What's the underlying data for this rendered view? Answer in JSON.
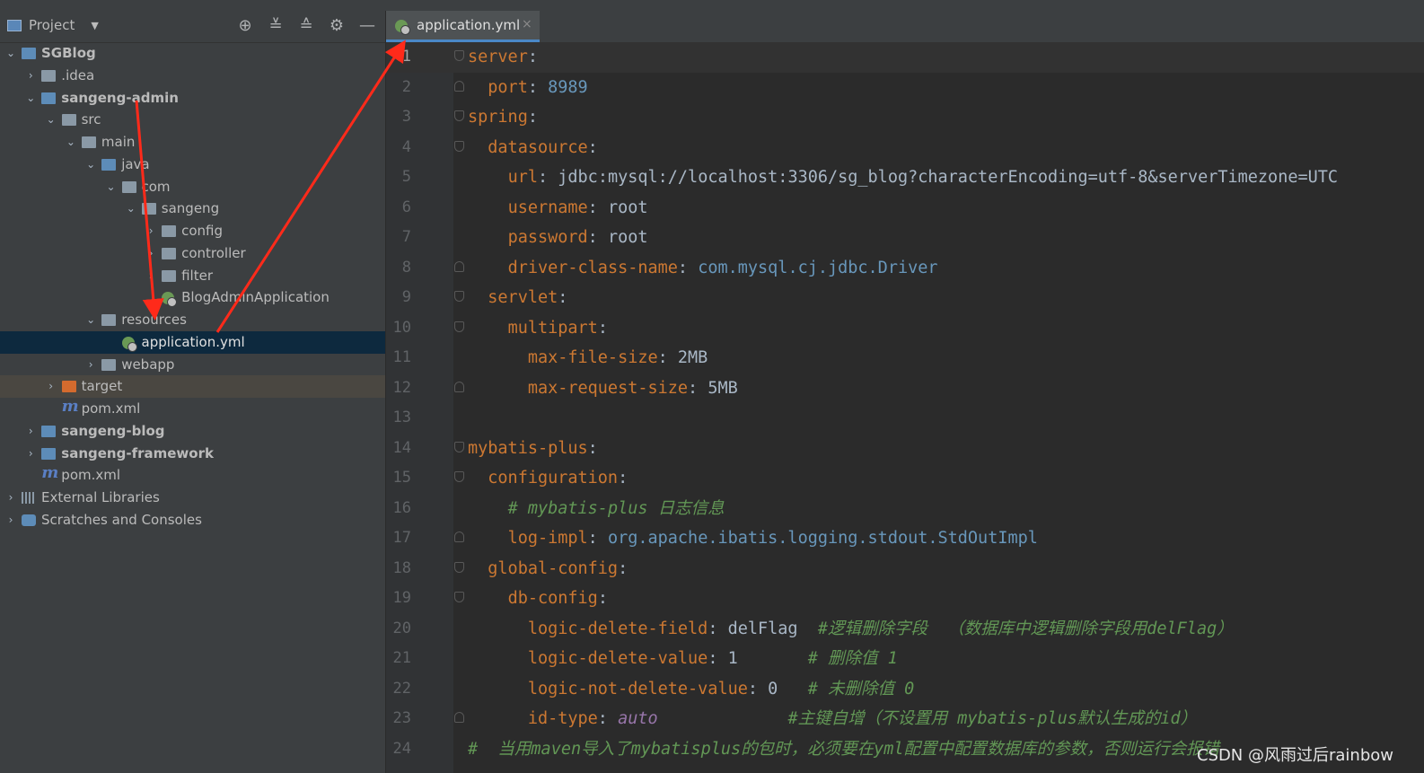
{
  "project_panel": {
    "title": "Project",
    "header_icons": [
      "locate-icon",
      "expand-all-icon",
      "collapse-all-icon",
      "settings-icon",
      "hide-icon"
    ],
    "tree": [
      {
        "label": "SGBlog",
        "path": "D:\\Java\\projects\\SGBlog",
        "depth": 0,
        "expanded": true,
        "icon": "module-folder-icon",
        "bold": true
      },
      {
        "label": ".idea",
        "depth": 1,
        "expanded": false,
        "icon": "folder-icon"
      },
      {
        "label": "sangeng-admin",
        "depth": 1,
        "expanded": true,
        "icon": "module-folder-icon",
        "bold": true
      },
      {
        "label": "src",
        "depth": 2,
        "expanded": true,
        "icon": "folder-icon"
      },
      {
        "label": "main",
        "depth": 3,
        "expanded": true,
        "icon": "folder-icon"
      },
      {
        "label": "java",
        "depth": 4,
        "expanded": true,
        "icon": "source-folder-icon"
      },
      {
        "label": "com",
        "depth": 5,
        "expanded": true,
        "icon": "package-icon"
      },
      {
        "label": "sangeng",
        "depth": 6,
        "expanded": true,
        "icon": "package-icon"
      },
      {
        "label": "config",
        "depth": 7,
        "expanded": false,
        "icon": "package-icon"
      },
      {
        "label": "controller",
        "depth": 7,
        "expanded": false,
        "icon": "package-icon"
      },
      {
        "label": "filter",
        "depth": 7,
        "expanded": false,
        "icon": "package-icon"
      },
      {
        "label": "BlogAdminApplication",
        "depth": 7,
        "leaf": true,
        "icon": "spring-boot-class-icon"
      },
      {
        "label": "resources",
        "depth": 4,
        "expanded": true,
        "icon": "resources-folder-icon"
      },
      {
        "label": "application.yml",
        "depth": 5,
        "leaf": true,
        "icon": "spring-yml-icon",
        "selected": true
      },
      {
        "label": "webapp",
        "depth": 4,
        "expanded": false,
        "icon": "folder-icon"
      },
      {
        "label": "target",
        "depth": 2,
        "expanded": false,
        "icon": "excluded-folder-icon",
        "highlight": true
      },
      {
        "label": "pom.xml",
        "depth": 2,
        "leaf": true,
        "icon": "maven-icon"
      },
      {
        "label": "sangeng-blog",
        "depth": 1,
        "expanded": false,
        "icon": "module-folder-icon",
        "bold": true
      },
      {
        "label": "sangeng-framework",
        "depth": 1,
        "expanded": false,
        "icon": "module-folder-icon",
        "bold": true
      },
      {
        "label": "pom.xml",
        "depth": 1,
        "leaf": true,
        "icon": "maven-icon"
      },
      {
        "label": "External Libraries",
        "depth": 0,
        "expanded": false,
        "icon": "libraries-icon"
      },
      {
        "label": "Scratches and Consoles",
        "depth": 0,
        "expanded": false,
        "icon": "scratches-icon"
      }
    ]
  },
  "editor": {
    "tab": {
      "label": "application.yml",
      "close": "×"
    },
    "lines": [
      {
        "n": "1",
        "parts": [
          [
            "k",
            "server"
          ],
          [
            "p",
            ":"
          ]
        ]
      },
      {
        "n": "2",
        "parts": [
          [
            "p",
            "  "
          ],
          [
            "k",
            "port"
          ],
          [
            "p",
            ": "
          ],
          [
            "v",
            "8989"
          ]
        ]
      },
      {
        "n": "3",
        "parts": [
          [
            "k",
            "spring"
          ],
          [
            "p",
            ":"
          ]
        ]
      },
      {
        "n": "4",
        "parts": [
          [
            "p",
            "  "
          ],
          [
            "k",
            "datasource"
          ],
          [
            "p",
            ":"
          ]
        ]
      },
      {
        "n": "5",
        "parts": [
          [
            "p",
            "    "
          ],
          [
            "k",
            "url"
          ],
          [
            "p",
            ": "
          ],
          [
            "s",
            "jdbc:mysql://localhost:3306/sg_blog?characterEncoding=utf-8&serverTimezone=UTC"
          ]
        ]
      },
      {
        "n": "6",
        "parts": [
          [
            "p",
            "    "
          ],
          [
            "k",
            "username"
          ],
          [
            "p",
            ": "
          ],
          [
            "s",
            "root"
          ]
        ]
      },
      {
        "n": "7",
        "parts": [
          [
            "p",
            "    "
          ],
          [
            "k",
            "password"
          ],
          [
            "p",
            ": "
          ],
          [
            "s",
            "root"
          ]
        ]
      },
      {
        "n": "8",
        "parts": [
          [
            "p",
            "    "
          ],
          [
            "k",
            "driver-class-name"
          ],
          [
            "p",
            ": "
          ],
          [
            "v",
            "com.mysql.cj.jdbc.Driver"
          ]
        ]
      },
      {
        "n": "9",
        "parts": [
          [
            "p",
            "  "
          ],
          [
            "k",
            "servlet"
          ],
          [
            "p",
            ":"
          ]
        ]
      },
      {
        "n": "10",
        "parts": [
          [
            "p",
            "    "
          ],
          [
            "k",
            "multipart"
          ],
          [
            "p",
            ":"
          ]
        ]
      },
      {
        "n": "11",
        "parts": [
          [
            "p",
            "      "
          ],
          [
            "k",
            "max-file-size"
          ],
          [
            "p",
            ": "
          ],
          [
            "s",
            "2MB"
          ]
        ]
      },
      {
        "n": "12",
        "parts": [
          [
            "p",
            "      "
          ],
          [
            "k",
            "max-request-size"
          ],
          [
            "p",
            ": "
          ],
          [
            "s",
            "5MB"
          ]
        ]
      },
      {
        "n": "13",
        "parts": []
      },
      {
        "n": "14",
        "parts": [
          [
            "k",
            "mybatis-plus"
          ],
          [
            "p",
            ":"
          ]
        ]
      },
      {
        "n": "15",
        "parts": [
          [
            "p",
            "  "
          ],
          [
            "k",
            "configuration"
          ],
          [
            "p",
            ":"
          ]
        ]
      },
      {
        "n": "16",
        "parts": [
          [
            "p",
            "    "
          ],
          [
            "c",
            "# mybatis-plus 日志信息"
          ]
        ]
      },
      {
        "n": "17",
        "parts": [
          [
            "p",
            "    "
          ],
          [
            "k",
            "log-impl"
          ],
          [
            "p",
            ": "
          ],
          [
            "v",
            "org.apache.ibatis.logging.stdout.StdOutImpl"
          ]
        ]
      },
      {
        "n": "18",
        "parts": [
          [
            "p",
            "  "
          ],
          [
            "k",
            "global-config"
          ],
          [
            "p",
            ":"
          ]
        ]
      },
      {
        "n": "19",
        "parts": [
          [
            "p",
            "    "
          ],
          [
            "k",
            "db-config"
          ],
          [
            "p",
            ":"
          ]
        ]
      },
      {
        "n": "20",
        "parts": [
          [
            "p",
            "      "
          ],
          [
            "k",
            "logic-delete-field"
          ],
          [
            "p",
            ": "
          ],
          [
            "s",
            "delFlag"
          ],
          [
            "p",
            "  "
          ],
          [
            "c",
            "#逻辑删除字段  （数据库中逻辑删除字段用delFlag）"
          ]
        ]
      },
      {
        "n": "21",
        "parts": [
          [
            "p",
            "      "
          ],
          [
            "k",
            "logic-delete-value"
          ],
          [
            "p",
            ": "
          ],
          [
            "s",
            "1"
          ],
          [
            "p",
            "       "
          ],
          [
            "c",
            "# 删除值 1"
          ]
        ]
      },
      {
        "n": "22",
        "parts": [
          [
            "p",
            "      "
          ],
          [
            "k",
            "logic-not-delete-value"
          ],
          [
            "p",
            ": "
          ],
          [
            "s",
            "0"
          ],
          [
            "p",
            "   "
          ],
          [
            "c",
            "# 未删除值 0"
          ]
        ]
      },
      {
        "n": "23",
        "parts": [
          [
            "p",
            "      "
          ],
          [
            "k",
            "id-type"
          ],
          [
            "p",
            ": "
          ],
          [
            "i",
            "auto"
          ],
          [
            "p",
            "             "
          ],
          [
            "c",
            "#主键自增（不设置用 mybatis-plus默认生成的id）"
          ]
        ]
      },
      {
        "n": "24",
        "parts": [
          [
            "c",
            "#  当用maven导入了mybatisplus的包时，必须要在yml配置中配置数据库的参数，否则运行会报错"
          ]
        ]
      }
    ]
  },
  "watermark": "CSDN @风雨过后rainbow",
  "colors": {
    "annotation_arrow": "#ff2a1a",
    "selection": "#0d293e",
    "key": "#cc7832",
    "number": "#6897bb",
    "comment": "#629755"
  }
}
